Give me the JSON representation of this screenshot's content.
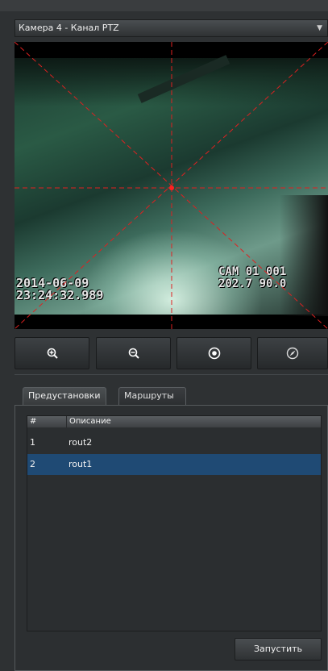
{
  "camera_select": {
    "value": "Камера 4 - Канал PTZ"
  },
  "video": {
    "osd_date": "2014-06-09",
    "osd_time": "23:24:32.989",
    "osd_cam": "CAM 01 001",
    "osd_pos": "202.7 90.0"
  },
  "ptz_controls": [
    {
      "icon": "zoom-in-icon"
    },
    {
      "icon": "zoom-out-icon"
    },
    {
      "icon": "record-dot-icon"
    },
    {
      "icon": "compass-icon"
    }
  ],
  "tabs": [
    {
      "label": "Предустановки"
    },
    {
      "label": "Маршруты"
    }
  ],
  "routes_table": {
    "headers": [
      "#",
      "Описание"
    ],
    "rows": [
      {
        "num": "1",
        "desc": "rout2"
      },
      {
        "num": "2",
        "desc": "rout1"
      }
    ],
    "selected_row": 2
  },
  "run_button": {
    "label": "Запустить"
  },
  "colors": {
    "selection": "#1f4a74",
    "crosshair": "#e02020"
  }
}
